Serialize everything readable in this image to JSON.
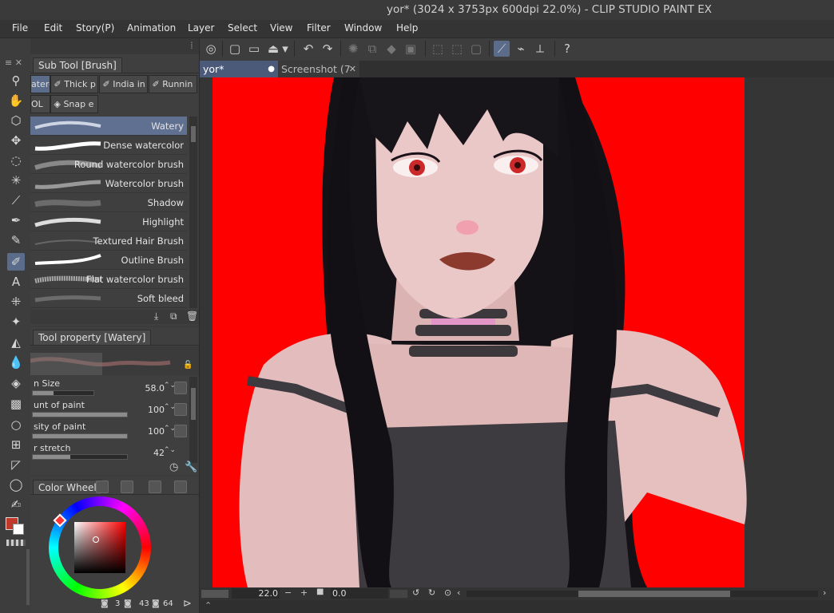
{
  "title": "yor* (3024 x 3753px 600dpi 22.0%)  - CLIP STUDIO PAINT EX",
  "menu": [
    "File",
    "Edit",
    "Story(P)",
    "Animation",
    "Layer",
    "Select",
    "View",
    "Filter",
    "Window",
    "Help"
  ],
  "subtool_panel": {
    "tab_label": "Sub Tool [Brush]",
    "groups": [
      "aterc",
      "Thick p",
      "India in",
      "Runnin",
      "OL",
      "Snap e"
    ],
    "brushes": [
      "Watery",
      "Dense watercolor",
      "Round watercolor brush",
      "Watercolor brush",
      "Shadow",
      "Highlight",
      "Textured Hair Brush",
      "Outline Brush",
      "Flat watercolor brush",
      "Soft bleed"
    ],
    "selected_index": 0
  },
  "tool_property": {
    "tab_label": "Tool property [Watery]",
    "properties": [
      {
        "label": "n Size",
        "value": "58.0",
        "fill": 0.34
      },
      {
        "label": "unt of paint",
        "value": "100",
        "fill": 1.0
      },
      {
        "label": "sity of paint",
        "value": "100",
        "fill": 1.0
      },
      {
        "label": "r stretch",
        "value": "42",
        "fill": 0.4
      }
    ]
  },
  "color_panel": {
    "tab_label": "Color Wheel",
    "values": [
      "3",
      "43",
      "64"
    ],
    "hue_color": "#ff0000",
    "main_color": "#c0392b"
  },
  "doc_tabs": [
    {
      "label": "yor*",
      "active": true
    },
    {
      "label": "Screenshot (7",
      "active": false
    }
  ],
  "status": {
    "zoom": "22.0",
    "angle": "0.0"
  },
  "colors": {
    "canvas_bg": "#ff0000",
    "accent": "#5a6c8a",
    "panel": "#3f3f3f",
    "hair": "#141216",
    "skin": "#e7c4c4",
    "dress": "#3d3a40"
  }
}
